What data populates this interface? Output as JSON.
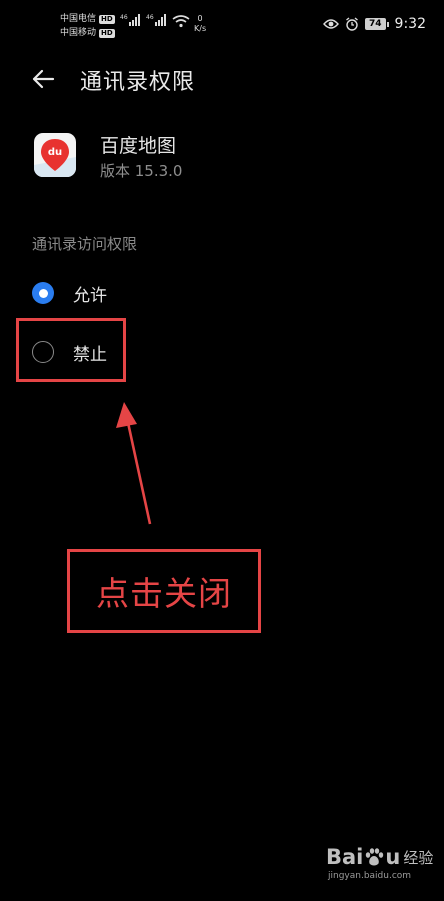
{
  "status_bar": {
    "carrier_1": "中国电信",
    "carrier_2": "中国移动",
    "hd_badge": "HD",
    "signal_tag": "46",
    "speed_value": "0",
    "speed_unit": "K/s",
    "battery": "74",
    "time": "9:32"
  },
  "header": {
    "title": "通讯录权限"
  },
  "app": {
    "name": "百度地图",
    "version": "版本 15.3.0",
    "icon_text": "du"
  },
  "section": {
    "label": "通讯录访问权限"
  },
  "options": [
    {
      "label": "允许",
      "selected": true
    },
    {
      "label": "禁止",
      "selected": false
    }
  ],
  "annotation": {
    "callout": "点击关闭",
    "color": "#e54546"
  },
  "watermark": {
    "brand_left": "Bai",
    "brand_right": "u",
    "brand_jingyan": "经验",
    "url": "jingyan.baidu.com"
  },
  "colors": {
    "accent": "#2a7df0",
    "background": "#000000"
  }
}
